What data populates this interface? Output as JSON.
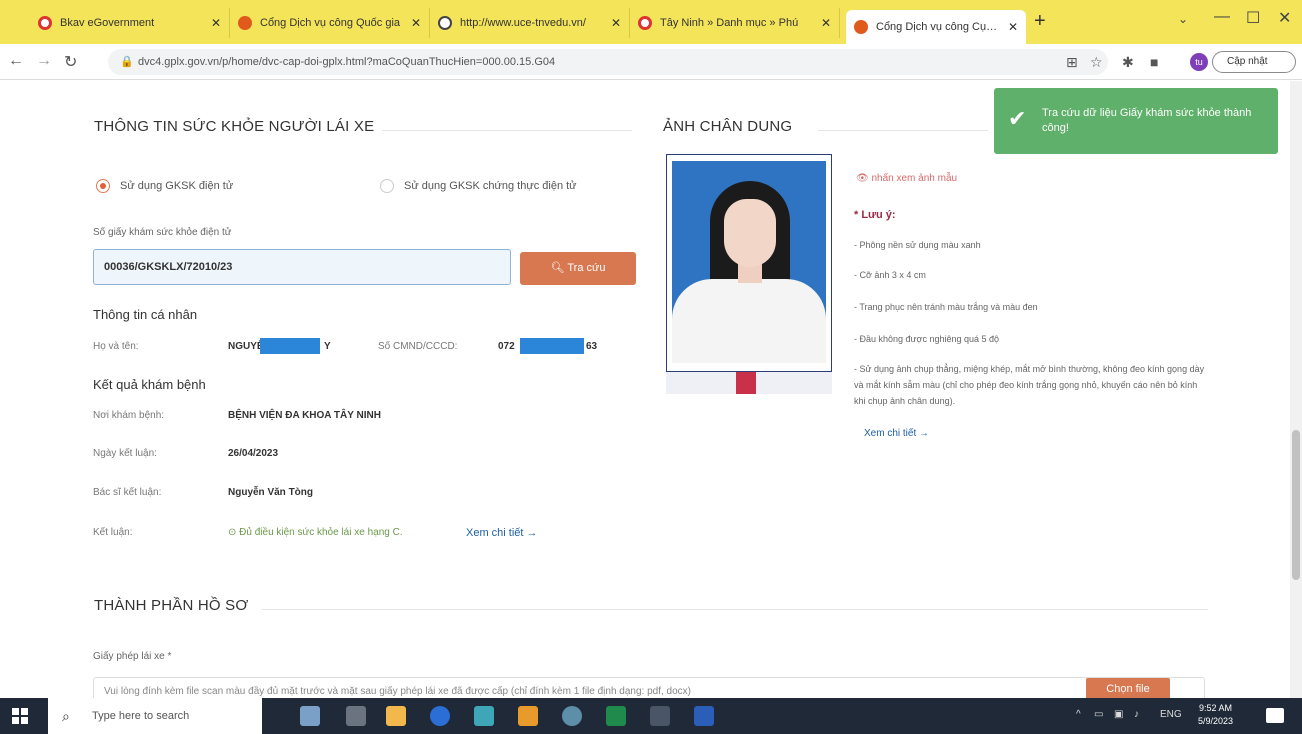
{
  "browser": {
    "tabs": [
      {
        "label": "Bkav eGovernment",
        "color": "#d33"
      },
      {
        "label": "Cổng Dịch vụ công Quốc gia",
        "color": "#e05a1c"
      },
      {
        "label": "http://www.uce-tnvedu.vn/",
        "color": "#444"
      },
      {
        "label": "Tây Ninh » Danh mục » Phú",
        "color": "#d33"
      },
      {
        "label": "Cổng Dịch vụ công Cục đườ",
        "color": "#e05a1c"
      }
    ],
    "url": "dvc4.gplx.gov.vn/p/home/dvc-cap-doi-gplx.html?maCoQuanThucHien=000.00.15.G04",
    "update_label": "Cập nhật"
  },
  "health": {
    "section_title": "THÔNG TIN SỨC KHỎE NGƯỜI LÁI XE",
    "radio_electronic": "Sử dụng GKSK điện tử",
    "radio_certified": "Sử dụng GKSK chứng thực điện tử",
    "cert_no_label": "Số giấy khám sức khỏe điện tử",
    "cert_no_value": "00036/GKSKLX/72010/23",
    "search_btn": "Tra cứu",
    "personal_title": "Thông tin cá nhân",
    "name_label": "Họ và tên:",
    "name_value_prefix": "NGUYỄ",
    "name_value_suffix": "Y",
    "id_label": "Số CMND/CCCD:",
    "id_value_prefix": "072",
    "id_value_suffix": "63",
    "result_title": "Kết quả khám bệnh",
    "place_label": "Nơi khám bệnh:",
    "place_value": "BỆNH VIỆN ĐA KHOA TÂY NINH",
    "date_label": "Ngày kết luận:",
    "date_value": "26/04/2023",
    "doctor_label": "Bác sĩ kết luận:",
    "doctor_value": "Nguyễn Văn Tòng",
    "conclusion_label": "Kết luận:",
    "conclusion_value": "⊙ Đủ điều kiện sức khỏe lái xe hạng C.",
    "detail_link": "Xem chi tiết →"
  },
  "portrait": {
    "section_title": "ẢNH CHÂN DUNG",
    "sample_link": "👁 nhấn xem ảnh mẫu",
    "note_title": "* Lưu ý:",
    "notes": [
      "- Phông nền sử dụng màu xanh",
      "- Cỡ ảnh 3 x 4 cm",
      "- Trang phục nên tránh màu trắng và màu đen",
      "- Đầu không được nghiêng quá 5 độ",
      "- Sử dụng ảnh chụp thẳng, miệng khép, mắt mở bình thường, không đeo kính gọng dày và mắt kính sẫm màu (chỉ cho phép đeo kính trắng gọng nhỏ, khuyến cáo nên bỏ kính khi chụp ảnh chân dung)."
    ],
    "detail_link": "Xem chi tiết →"
  },
  "toast": {
    "message": "Tra cứu dữ liệu Giấy khám sức khỏe thành công!"
  },
  "dossier": {
    "section_title": "THÀNH PHẦN HỒ SƠ",
    "license_label": "Giấy phép lái xe *",
    "upload_placeholder": "Vui lòng đính kèm file scan màu đầy đủ mặt trước và mặt sau giấy phép lái xe đã được cấp (chỉ đính kèm 1 file định dạng: pdf, docx)",
    "upload_btn": "Chọn file"
  },
  "taskbar": {
    "search_placeholder": "Type here to search",
    "lang": "ENG",
    "time": "9:52 AM",
    "date": "5/9/2023"
  }
}
